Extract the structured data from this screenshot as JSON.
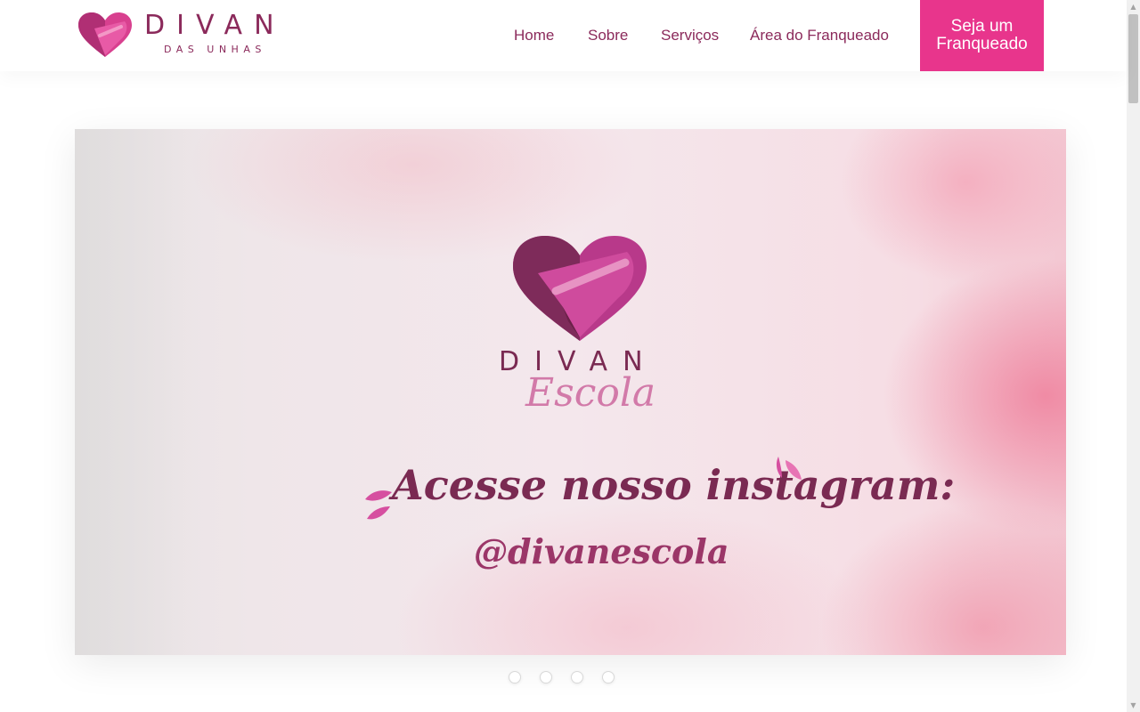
{
  "brand": {
    "name": "DIVAN",
    "tagline": "DAS UNHAS"
  },
  "nav": {
    "items": [
      {
        "label": "Home"
      },
      {
        "label": "Sobre"
      },
      {
        "label": "Serviços"
      },
      {
        "label": "Área do Franqueado"
      }
    ],
    "cta_label": "Seja um Franqueado"
  },
  "hero": {
    "logo_word": "DIVAN",
    "logo_script": "Escola",
    "headline": "Acesse nosso instagram:",
    "handle": "@divanescola"
  },
  "carousel": {
    "slide_count": 4,
    "dots": [
      "1",
      "2",
      "3",
      "4"
    ]
  },
  "colors": {
    "brand_dark": "#8b2a5b",
    "brand_pink": "#e8358c",
    "heart_light": "#d64fa0",
    "heart_dark": "#8a2e5e"
  },
  "icons": {
    "logo": "heart-icon",
    "scroll_up": "arrow-up-icon",
    "scroll_down": "arrow-down-icon"
  }
}
